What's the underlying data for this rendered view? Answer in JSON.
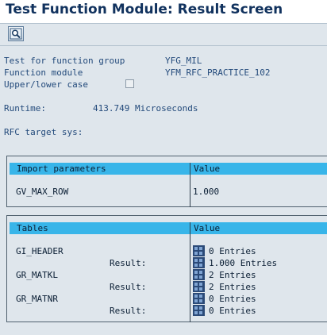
{
  "window": {
    "title": "Test Function Module: Result Screen"
  },
  "toolbar": {
    "display_button_icon": "magnifier-icon"
  },
  "info": {
    "function_group_label": "Test for function group",
    "function_group_value": "YFG_MIL",
    "function_module_label": "Function module",
    "function_module_value": "YFM_RFC_PRACTICE_102",
    "case_label": "Upper/lower case",
    "case_checked": false,
    "runtime_label": "Runtime:",
    "runtime_value": "413.749 Microseconds",
    "rfc_label": "RFC target sys:"
  },
  "import_params": {
    "col_param": "Import parameters",
    "col_value": "Value",
    "rows": [
      {
        "name": "GV_MAX_ROW",
        "value": "1.000"
      }
    ]
  },
  "tables": {
    "col_param": "Tables",
    "col_value": "Value",
    "result_label": "Result:",
    "rows": [
      {
        "name": "GI_HEADER",
        "value": "0 Entries",
        "result": "1.000 Entries"
      },
      {
        "name": "GR_MATKL",
        "value": "2 Entries",
        "result": "2 Entries"
      },
      {
        "name": "GR_MATNR",
        "value": "0 Entries",
        "result": "0 Entries"
      }
    ]
  },
  "colors": {
    "header_bg": "#38b5e9",
    "label_text": "#234a7b",
    "title_text": "#11325e"
  }
}
